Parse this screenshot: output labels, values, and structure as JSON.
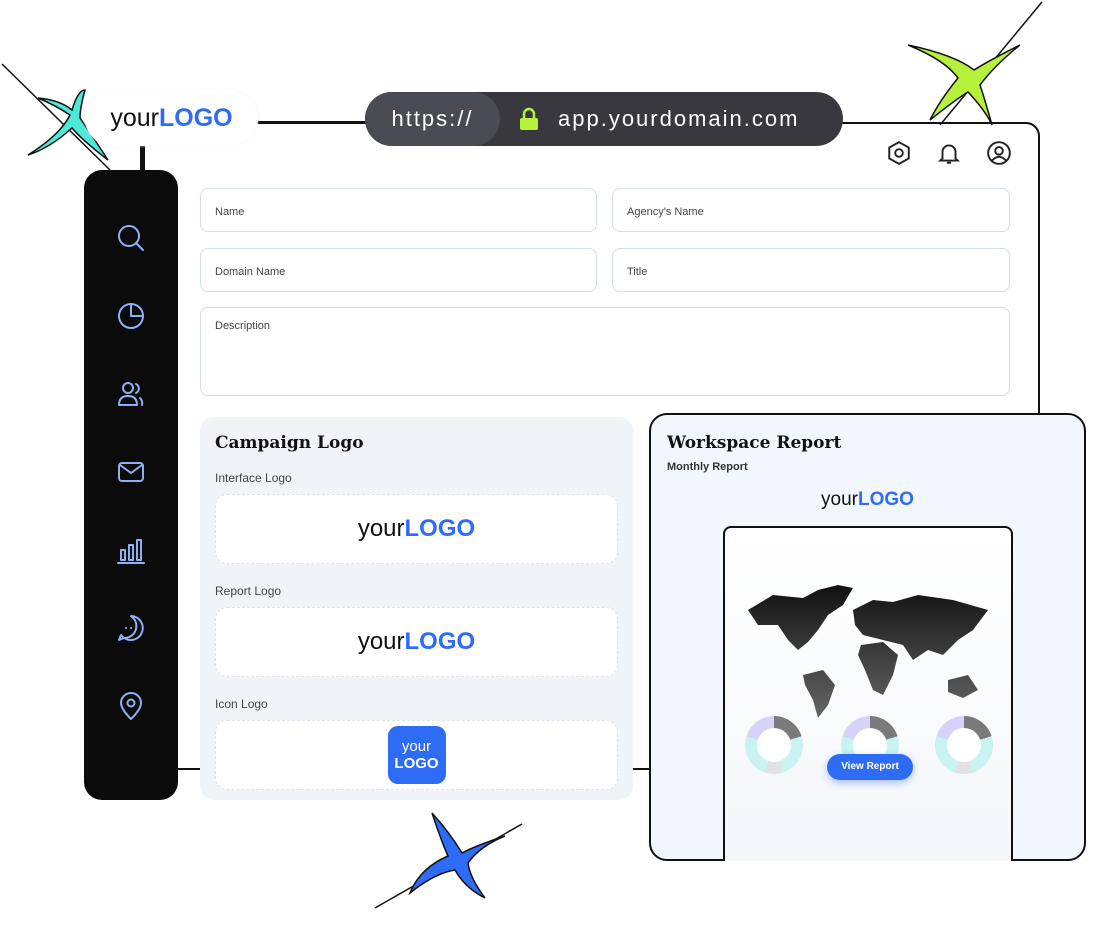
{
  "brand": {
    "logo_prefix": "your",
    "logo_suffix": "LOGO"
  },
  "url": {
    "protocol": "https://",
    "domain": "app.yourdomain.com"
  },
  "header_icons": [
    "settings-icon",
    "bell-icon",
    "user-icon"
  ],
  "sidebar": {
    "items": [
      "search-icon",
      "chart-pie-icon",
      "users-icon",
      "mail-icon",
      "bar-chart-icon",
      "chat-icon",
      "location-icon"
    ]
  },
  "form": {
    "name": "Name",
    "agency": "Agency's Name",
    "domain": "Domain Name",
    "title": "Title",
    "description": "Description"
  },
  "campaign": {
    "title": "Campaign Logo",
    "interface_label": "Interface Logo",
    "report_label": "Report Logo",
    "icon_label": "Icon Logo"
  },
  "report": {
    "title": "Workspace Report",
    "subtitle": "Monthly Report",
    "button": "View Report"
  },
  "colors": {
    "accent": "#2f6cf6",
    "sidebar": "#0b0b0b",
    "lock": "#b6f23b"
  }
}
